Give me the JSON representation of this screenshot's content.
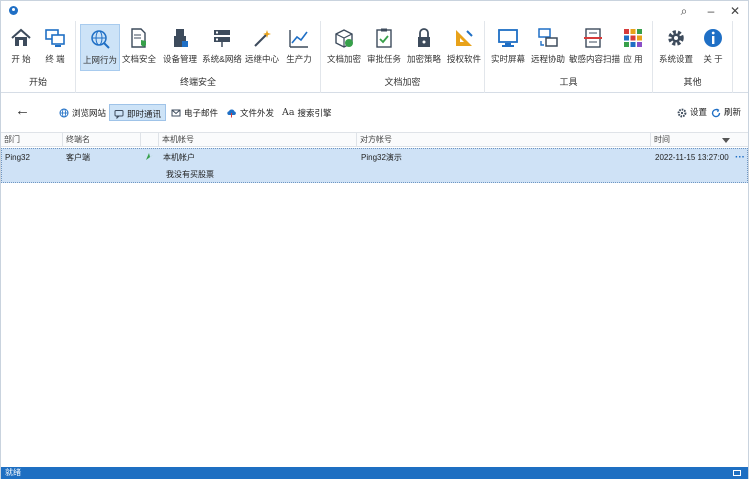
{
  "titlebar": {
    "search": "⌕",
    "minimize": "–",
    "close": "✕"
  },
  "ribbon": {
    "groups": [
      {
        "label": "开始",
        "buttons": [
          {
            "label": "开 始",
            "icon": "home-icon"
          },
          {
            "label": "终 端",
            "icon": "monitors-icon"
          }
        ]
      },
      {
        "label": "终端安全",
        "buttons": [
          {
            "label": "上网行为",
            "icon": "globe-search-icon",
            "active": true
          },
          {
            "label": "文档安全",
            "icon": "document-shield-icon"
          },
          {
            "label": "设备管理",
            "icon": "usb-device-icon"
          },
          {
            "label": "系统&网络",
            "icon": "network-icon"
          },
          {
            "label": "远继中心",
            "icon": "magic-wand-icon"
          },
          {
            "label": "生产力",
            "icon": "chart-icon"
          }
        ]
      },
      {
        "label": "文档加密",
        "buttons": [
          {
            "label": "文档加密",
            "icon": "box-lock-icon"
          },
          {
            "label": "审批任务",
            "icon": "clipboard-check-icon"
          },
          {
            "label": "加密策略",
            "icon": "padlock-icon"
          },
          {
            "label": "授权软件",
            "icon": "triangle-ruler-icon"
          }
        ]
      },
      {
        "label": "工具",
        "buttons": [
          {
            "label": "实时屏幕",
            "icon": "screen-icon"
          },
          {
            "label": "远程协助",
            "icon": "remote-assist-icon"
          },
          {
            "label": "敏感内容扫描",
            "icon": "scan-document-icon"
          },
          {
            "label": "应 用",
            "icon": "apps-grid-icon"
          }
        ]
      },
      {
        "label": "其他",
        "buttons": [
          {
            "label": "系统设置",
            "icon": "gear-icon"
          },
          {
            "label": "关 于",
            "icon": "info-icon"
          }
        ]
      }
    ]
  },
  "subbar": {
    "tabs": [
      {
        "label": "浏览网站",
        "icon": "globe-icon"
      },
      {
        "label": "即时通讯",
        "icon": "chat-icon",
        "active": true
      },
      {
        "label": "电子邮件",
        "icon": "mail-icon"
      },
      {
        "label": "文件外发",
        "icon": "cloud-upload-icon"
      },
      {
        "label": "搜索引擎",
        "icon": "font-aa-icon"
      }
    ],
    "settings_label": "设置",
    "refresh_label": "刷新"
  },
  "grid": {
    "columns": [
      "部门",
      "终端名",
      "",
      "本机帐号",
      "对方帐号",
      "时间"
    ],
    "row": {
      "dept": "Ping32",
      "terminal": "客户端",
      "local_account": "本机帐户",
      "message": "我没有买股票",
      "remote_account": "Ping32演示",
      "time": "2022-11-15 13:27:00"
    }
  },
  "status": {
    "text": "就绪"
  },
  "colors": {
    "accent": "#1e6fc2",
    "selected_row": "#cfe2f6",
    "active_tab": "#cde3f7"
  }
}
